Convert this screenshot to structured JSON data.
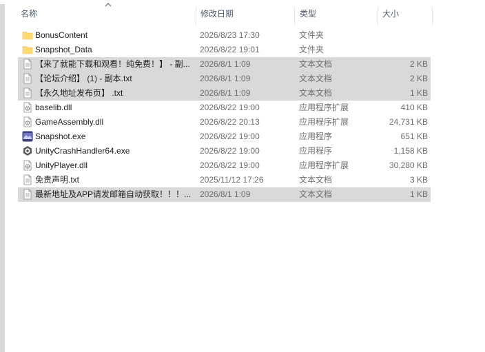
{
  "header": {
    "col_name": "名称",
    "col_date": "修改日期",
    "col_type": "类型",
    "col_size": "大小"
  },
  "rows": [
    {
      "name": "BonusContent",
      "date": "2026/8/23 17:30",
      "type": "文件夹",
      "size": "",
      "icon": "folder-icon",
      "selected": false
    },
    {
      "name": "Snapshot_Data",
      "date": "2026/8/22 19:01",
      "type": "文件夹",
      "size": "",
      "icon": "folder-icon",
      "selected": false
    },
    {
      "name": "【来了就能下载和观看！纯免费！】 - 副...",
      "date": "2026/8/1 1:09",
      "type": "文本文档",
      "size": "2 KB",
      "icon": "text-file-icon",
      "selected": true
    },
    {
      "name": "【论坛介绍】 (1) - 副本.txt",
      "date": "2026/8/1 1:09",
      "type": "文本文档",
      "size": "2 KB",
      "icon": "text-file-icon",
      "selected": true
    },
    {
      "name": "【永久地址发布页】 .txt",
      "date": "2026/8/1 1:09",
      "type": "文本文档",
      "size": "1 KB",
      "icon": "text-file-icon",
      "selected": true
    },
    {
      "name": "baselib.dll",
      "date": "2026/8/22 19:00",
      "type": "应用程序扩展",
      "size": "410 KB",
      "icon": "dll-file-icon",
      "selected": false
    },
    {
      "name": "GameAssembly.dll",
      "date": "2026/8/22 20:13",
      "type": "应用程序扩展",
      "size": "24,731 KB",
      "icon": "dll-file-icon",
      "selected": false
    },
    {
      "name": "Snapshot.exe",
      "date": "2026/8/22 19:00",
      "type": "应用程序",
      "size": "651 KB",
      "icon": "snapshot-app-icon",
      "selected": false
    },
    {
      "name": "UnityCrashHandler64.exe",
      "date": "2026/8/22 19:00",
      "type": "应用程序",
      "size": "1,158 KB",
      "icon": "unity-app-icon",
      "selected": false
    },
    {
      "name": "UnityPlayer.dll",
      "date": "2026/8/22 19:00",
      "type": "应用程序扩展",
      "size": "30,280 KB",
      "icon": "dll-file-icon",
      "selected": false
    },
    {
      "name": "免责声明.txt",
      "date": "2025/11/12 17:26",
      "type": "文本文档",
      "size": "3 KB",
      "icon": "text-file-icon",
      "selected": false
    },
    {
      "name": "最新地址及APP请发邮箱自动获取！！！...",
      "date": "2026/8/1 1:09",
      "type": "文本文档",
      "size": "1 KB",
      "icon": "text-file-icon",
      "selected": true
    }
  ]
}
